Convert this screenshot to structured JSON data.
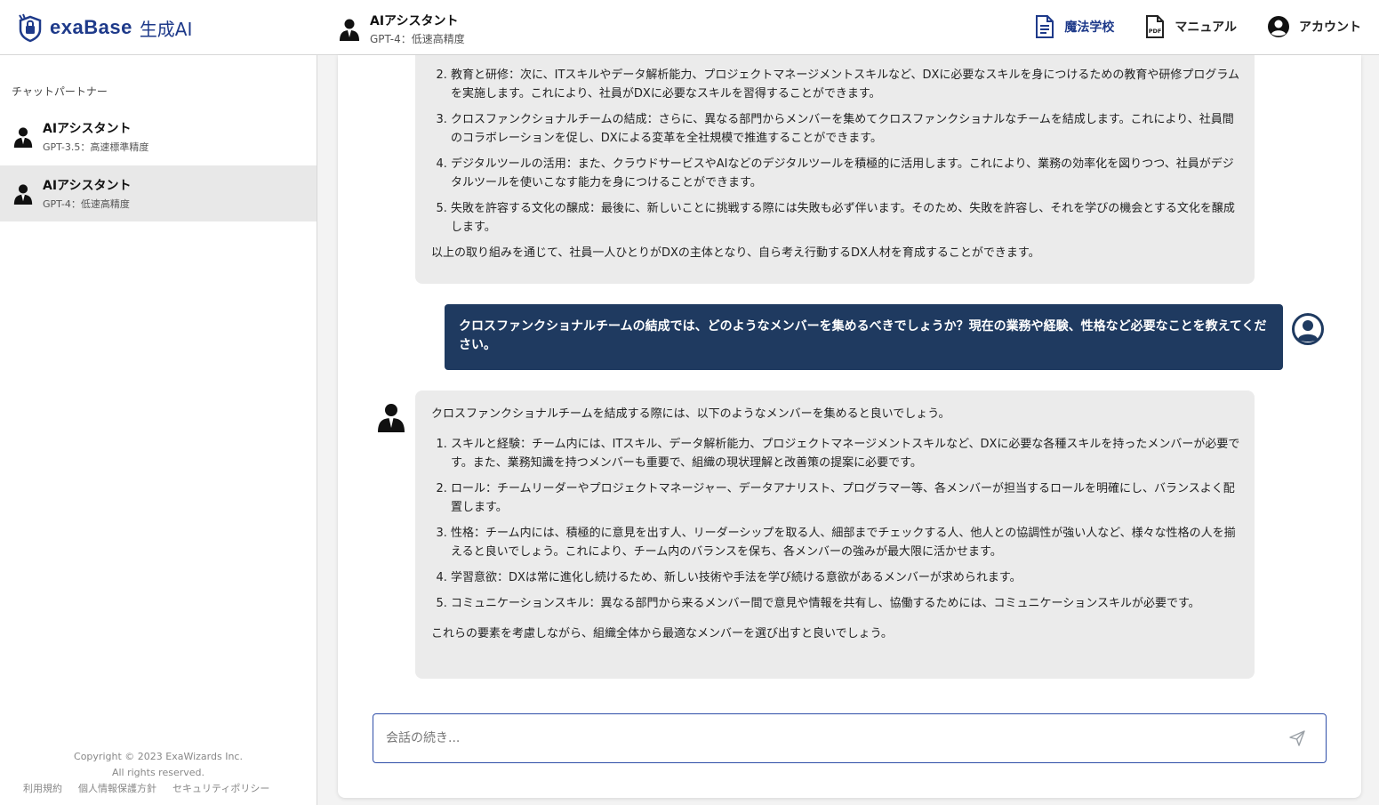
{
  "header": {
    "brand": "exaBase",
    "brand_sub": "生成AI",
    "agent_name": "AIアシスタント",
    "agent_model": "GPT-4：低速高精度",
    "nav": [
      {
        "label": "魔法学校",
        "icon": "document-icon"
      },
      {
        "label": "マニュアル",
        "icon": "pdf-icon"
      },
      {
        "label": "アカウント",
        "icon": "account-icon"
      }
    ]
  },
  "sidebar": {
    "heading": "チャットパートナー",
    "partners": [
      {
        "name": "AIアシスタント",
        "model": "GPT-3.5：高速標準精度"
      },
      {
        "name": "AIアシスタント",
        "model": "GPT-4：低速高精度"
      }
    ],
    "copyright": "Copyright © 2023 ExaWizards Inc.",
    "rights": "All rights reserved.",
    "links": [
      "利用規約",
      "個人情報保護方針",
      "セキュリティポリシー"
    ]
  },
  "chat": {
    "prev_answer": {
      "items": [
        {
          "num": 2,
          "text": "教育と研修：次に、ITスキルやデータ解析能力、プロジェクトマネージメントスキルなど、DXに必要なスキルを身につけるための教育や研修プログラムを実施します。これにより、社員がDXに必要なスキルを習得することができます。"
        },
        {
          "num": 3,
          "text": "クロスファンクショナルチームの結成：さらに、異なる部門からメンバーを集めてクロスファンクショナルなチームを結成します。これにより、社員間のコラボレーションを促し、DXによる変革を全社規模で推進することができます。"
        },
        {
          "num": 4,
          "text": "デジタルツールの活用：また、クラウドサービスやAIなどのデジタルツールを積極的に活用します。これにより、業務の効率化を図りつつ、社員がデジタルツールを使いこなす能力を身につけることができます。"
        },
        {
          "num": 5,
          "text": "失敗を許容する文化の醸成：最後に、新しいことに挑戦する際には失敗も必ず伴います。そのため、失敗を許容し、それを学びの機会とする文化を醸成します。"
        }
      ],
      "closing": "以上の取り組みを通じて、社員一人ひとりがDXの主体となり、自ら考え行動するDX人材を育成することができます。"
    },
    "user_message": "クロスファンクショナルチームの結成では、どのようなメンバーを集めるべきでしょうか？現在の業務や経験、性格など必要なことを教えてください。",
    "answer": {
      "intro": "クロスファンクショナルチームを結成する際には、以下のようなメンバーを集めると良いでしょう。",
      "items": [
        {
          "num": 1,
          "text": "スキルと経験：チーム内には、ITスキル、データ解析能力、プロジェクトマネージメントスキルなど、DXに必要な各種スキルを持ったメンバーが必要です。また、業務知識を持つメンバーも重要で、組織の現状理解と改善策の提案に必要です。"
        },
        {
          "num": 2,
          "text": "ロール：チームリーダーやプロジェクトマネージャー、データアナリスト、プログラマー等、各メンバーが担当するロールを明確にし、バランスよく配置します。"
        },
        {
          "num": 3,
          "text": "性格：チーム内には、積極的に意見を出す人、リーダーシップを取る人、細部までチェックする人、他人との協調性が強い人など、様々な性格の人を揃えると良いでしょう。これにより、チーム内のバランスを保ち、各メンバーの強みが最大限に活かせます。"
        },
        {
          "num": 4,
          "text": "学習意欲：DXは常に進化し続けるため、新しい技術や手法を学び続ける意欲があるメンバーが求められます。"
        },
        {
          "num": 5,
          "text": "コミュニケーションスキル：異なる部門から来るメンバー間で意見や情報を共有し、協働するためには、コミュニケーションスキルが必要です。"
        }
      ],
      "closing": "これらの要素を考慮しながら、組織全体から最適なメンバーを選び出すと良いでしょう。"
    },
    "input": {
      "placeholder": "会話の続き...",
      "value": ""
    }
  },
  "colors": {
    "brand": "#1e3a8a",
    "user_bubble": "#1f3a60",
    "ai_bubble": "#ebebeb",
    "input_border": "#2f4ea8"
  }
}
